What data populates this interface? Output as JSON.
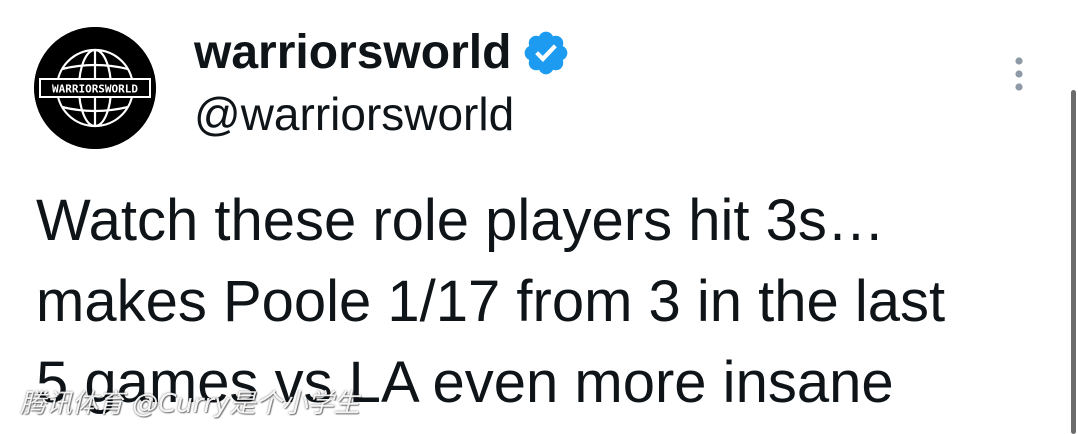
{
  "account": {
    "display_name": "warriorsworld",
    "handle": "@warriorsworld",
    "avatar_text": "WARRIORSWORLD",
    "verified_icon": "verified-badge-icon",
    "verified_color": "#1d9bf0"
  },
  "menu": {
    "icon": "more-vertical-icon"
  },
  "tweet": {
    "lines": [
      "Watch these role players hit 3s…",
      "makes Poole 1/17 from 3 in the last",
      "5 games vs LA even more insane"
    ]
  },
  "watermark": {
    "text": "腾讯体育 @Curry是个小学生"
  }
}
